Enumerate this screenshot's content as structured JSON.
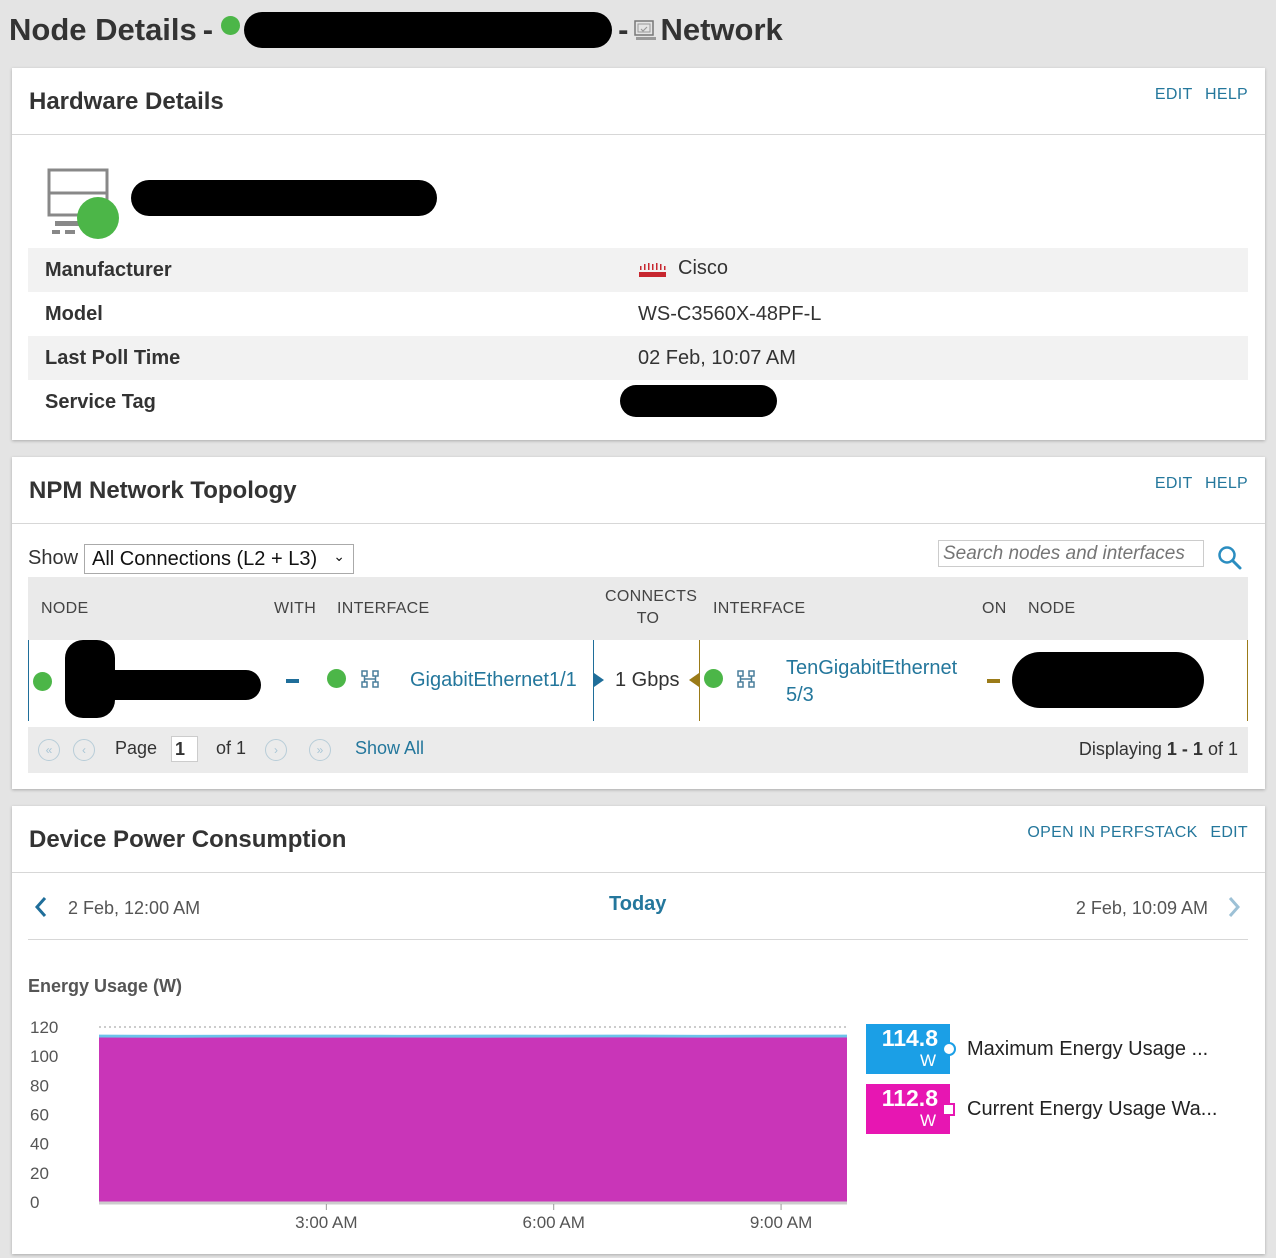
{
  "header": {
    "title_prefix": "Node Details",
    "separator": "-",
    "title_suffix": "Network"
  },
  "hardware": {
    "title": "Hardware Details",
    "edit": "EDIT",
    "help": "HELP",
    "rows": [
      {
        "label": "Manufacturer",
        "value": "Cisco",
        "icon": "cisco-logo-icon"
      },
      {
        "label": "Model",
        "value": "WS-C3560X-48PF-L"
      },
      {
        "label": "Last Poll Time",
        "value": "02 Feb, 10:07 AM"
      },
      {
        "label": "Service Tag",
        "value": ""
      }
    ]
  },
  "topology": {
    "title": "NPM Network Topology",
    "edit": "EDIT",
    "help": "HELP",
    "show_label": "Show",
    "show_selected": "All Connections (L2 + L3)",
    "search_placeholder": "Search nodes and interfaces",
    "columns": {
      "node": "NODE",
      "with": "WITH",
      "interface": "INTERFACE",
      "connects_to_1": "CONNECTS",
      "connects_to_2": "TO",
      "interface2": "INTERFACE",
      "on": "ON",
      "node2": "NODE"
    },
    "row": {
      "interface": "GigabitEthernet1/1",
      "speed": "1 Gbps",
      "remote_interface_1": "TenGigabitEthernet",
      "remote_interface_2": "5/3"
    },
    "pager": {
      "page_label": "Page",
      "page_value": "1",
      "of_label": "of 1",
      "show_all": "Show All",
      "displaying": "Displaying",
      "range": "1 - 1",
      "of": "of 1"
    }
  },
  "power": {
    "title": "Device Power Consumption",
    "open_perfstack": "OPEN IN PERFSTACK",
    "edit": "EDIT",
    "range_start": "2 Feb, 12:00 AM",
    "range_label": "Today",
    "range_end": "2 Feb, 10:09 AM",
    "colors": {
      "maximum": "#1b9fe6",
      "current": "#e716b2",
      "area": "#c935b8",
      "max_line": "#6cc3ea"
    },
    "legend": [
      {
        "value": "114.8",
        "unit": "W",
        "label": "Maximum Energy Usage ..."
      },
      {
        "value": "112.8",
        "unit": "W",
        "label": "Current Energy Usage Wa..."
      }
    ]
  },
  "chart_data": {
    "type": "area",
    "title": "Energy Usage (W)",
    "ylim": [
      0,
      120
    ],
    "y_ticks": [
      "120",
      "100",
      "80",
      "60",
      "40",
      "20",
      "0"
    ],
    "x_ticks": [
      "3:00 AM",
      "6:00 AM",
      "9:00 AM"
    ],
    "x": [
      "0:10",
      "1:00",
      "2:00",
      "3:00",
      "4:00",
      "5:00",
      "6:00",
      "7:00",
      "8:00",
      "9:00",
      "9:55"
    ],
    "series": [
      {
        "name": "Maximum Energy Usage ...",
        "values": [
          114.8,
          114.6,
          114.7,
          114.8,
          114.6,
          114.8,
          114.7,
          114.8,
          114.6,
          114.7,
          114.8
        ]
      },
      {
        "name": "Current Energy Usage Wa...",
        "values": [
          112.8,
          112.6,
          112.9,
          112.7,
          112.8,
          112.6,
          112.8,
          112.9,
          112.7,
          112.8,
          112.8
        ]
      }
    ],
    "grid": true
  }
}
